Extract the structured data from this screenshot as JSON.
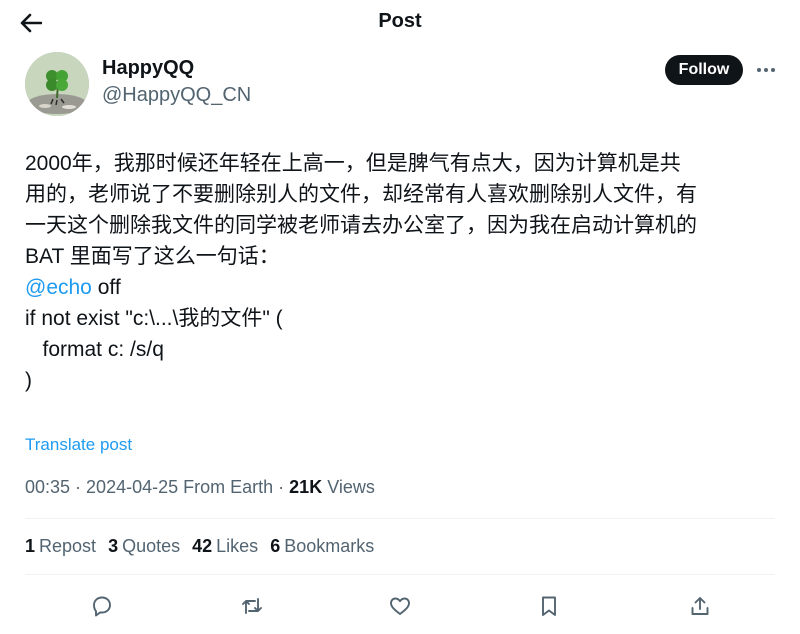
{
  "header": {
    "title": "Post",
    "back_icon": "arrow-left-icon"
  },
  "author": {
    "display_name": "HappyQQ",
    "handle": "@HappyQQ_CN",
    "avatar": "clover-avatar",
    "follow_label": "Follow",
    "more_icon": "more-horizontal-icon"
  },
  "post": {
    "lines": [
      "2000年，我那时候还年轻在上高一，但是脾气有点大，因为计算机是共",
      "用的，老师说了不要删除别人的文件，却经常有人喜欢删除别人文件，有",
      "一天这个删除我文件的同学被老师请去办公室了，因为我在启动计算机的",
      "BAT 里面写了这么一句话："
    ],
    "code_mention": "@echo",
    "code_mention_rest": " off",
    "code_lines": [
      "if not exist \"c:\\...\\我的文件\" (",
      "   format c: /s/q",
      ")"
    ],
    "translate_label": "Translate post"
  },
  "meta": {
    "time": "00:35",
    "date": "2024-04-25",
    "source": "From Earth",
    "separator": " · ",
    "views_count": "21K",
    "views_label": " Views"
  },
  "stats": {
    "reposts": {
      "count": "1",
      "label": "Repost"
    },
    "quotes": {
      "count": "3",
      "label": "Quotes"
    },
    "likes": {
      "count": "42",
      "label": "Likes"
    },
    "bookmarks": {
      "count": "6",
      "label": "Bookmarks"
    }
  },
  "actions": [
    "reply-icon",
    "repost-icon",
    "like-icon",
    "bookmark-icon",
    "share-icon"
  ],
  "colors": {
    "accent": "#1d9bf0",
    "text": "#0f1419",
    "secondary": "#536471",
    "follow_bg": "#0f1419",
    "divider": "#eff3f4"
  }
}
